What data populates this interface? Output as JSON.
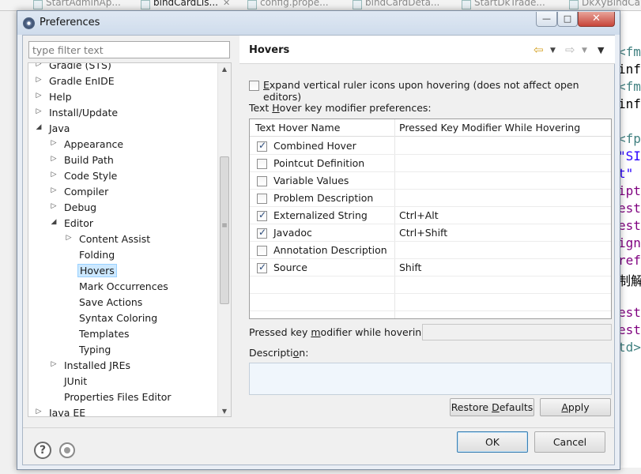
{
  "background_tabs": [
    {
      "label": "StartAdminAp...",
      "active": false
    },
    {
      "label": "bindCardLis...",
      "active": true
    },
    {
      "label": "config.prope...",
      "active": false
    },
    {
      "label": "bindCardDeta...",
      "active": false
    },
    {
      "label": "StartDkTrade...",
      "active": false
    },
    {
      "label": "DkXyBindCar",
      "active": false
    }
  ],
  "background_code": [
    {
      "text": "<fm",
      "color": "#3f7f7f"
    },
    {
      "text": "inf",
      "color": "#000000"
    },
    {
      "text": "<fm",
      "color": "#3f7f7f"
    },
    {
      "text": "inf",
      "color": "#000000"
    },
    {
      "text": "",
      "color": "#000000"
    },
    {
      "text": "<fp",
      "color": "#3f7f7f"
    },
    {
      "text": "\"SI",
      "color": "#2a00ff"
    },
    {
      "text": "t\"",
      "color": "#2a00ff"
    },
    {
      "text": "ipt",
      "color": "#7f007f"
    },
    {
      "text": "est",
      "color": "#7f007f"
    },
    {
      "text": "est",
      "color": "#7f007f"
    },
    {
      "text": "ign",
      "color": "#7f007f"
    },
    {
      "text": "ref",
      "color": "#7f007f"
    },
    {
      "text": "制解",
      "color": "#000000"
    },
    {
      "text": "",
      "color": "#000000"
    },
    {
      "text": "est",
      "color": "#7f007f"
    },
    {
      "text": "est",
      "color": "#7f007f"
    },
    {
      "text": "td>",
      "color": "#3f7f7f"
    }
  ],
  "dialog": {
    "title": "Preferences",
    "filter_placeholder": "type filter text",
    "window_buttons": {
      "minimize": "—",
      "maximize": "□",
      "close": "✕"
    }
  },
  "tree": [
    {
      "label": "Gradle (STS)",
      "level": 0,
      "arrow": "▷",
      "selected": false
    },
    {
      "label": "Gradle EnIDE",
      "level": 0,
      "arrow": "▷",
      "selected": false
    },
    {
      "label": "Help",
      "level": 0,
      "arrow": "▷",
      "selected": false
    },
    {
      "label": "Install/Update",
      "level": 0,
      "arrow": "▷",
      "selected": false
    },
    {
      "label": "Java",
      "level": 0,
      "arrow": "◢",
      "selected": false
    },
    {
      "label": "Appearance",
      "level": 1,
      "arrow": "▷",
      "selected": false
    },
    {
      "label": "Build Path",
      "level": 1,
      "arrow": "▷",
      "selected": false
    },
    {
      "label": "Code Style",
      "level": 1,
      "arrow": "▷",
      "selected": false
    },
    {
      "label": "Compiler",
      "level": 1,
      "arrow": "▷",
      "selected": false
    },
    {
      "label": "Debug",
      "level": 1,
      "arrow": "▷",
      "selected": false
    },
    {
      "label": "Editor",
      "level": 1,
      "arrow": "◢",
      "selected": false
    },
    {
      "label": "Content Assist",
      "level": 2,
      "arrow": "▷",
      "selected": false
    },
    {
      "label": "Folding",
      "level": 2,
      "arrow": "",
      "selected": false
    },
    {
      "label": "Hovers",
      "level": 2,
      "arrow": "",
      "selected": true
    },
    {
      "label": "Mark Occurrences",
      "level": 2,
      "arrow": "",
      "selected": false
    },
    {
      "label": "Save Actions",
      "level": 2,
      "arrow": "",
      "selected": false
    },
    {
      "label": "Syntax Coloring",
      "level": 2,
      "arrow": "",
      "selected": false
    },
    {
      "label": "Templates",
      "level": 2,
      "arrow": "",
      "selected": false
    },
    {
      "label": "Typing",
      "level": 2,
      "arrow": "",
      "selected": false
    },
    {
      "label": "Installed JREs",
      "level": 1,
      "arrow": "▷",
      "selected": false
    },
    {
      "label": "JUnit",
      "level": 1,
      "arrow": "",
      "selected": false
    },
    {
      "label": "Properties Files Editor",
      "level": 1,
      "arrow": "",
      "selected": false
    },
    {
      "label": "Java EE",
      "level": 0,
      "arrow": "▷",
      "selected": false
    }
  ],
  "page": {
    "title": "Hovers",
    "expand_label": "Expand vertical ruler icons upon hovering (does not affect open editors)",
    "expand_checked": false,
    "modifier_prefs_label": "Text Hover key modifier preferences:",
    "table_headers": {
      "name": "Text Hover Name",
      "modifier": "Pressed Key Modifier While Hovering"
    },
    "hovers": [
      {
        "name": "Combined Hover",
        "checked": true,
        "modifier": ""
      },
      {
        "name": "Pointcut Definition",
        "checked": false,
        "modifier": ""
      },
      {
        "name": "Variable Values",
        "checked": false,
        "modifier": ""
      },
      {
        "name": "Problem Description",
        "checked": false,
        "modifier": ""
      },
      {
        "name": "Externalized String",
        "checked": true,
        "modifier": "Ctrl+Alt"
      },
      {
        "name": "Javadoc",
        "checked": true,
        "modifier": "Ctrl+Shift"
      },
      {
        "name": "Annotation Description",
        "checked": false,
        "modifier": ""
      },
      {
        "name": "Source",
        "checked": true,
        "modifier": "Shift"
      }
    ],
    "pressed_key_label": "Pressed key modifier while hovering:",
    "pressed_key_value": "",
    "description_label": "Description:",
    "description_value": "",
    "restore_defaults": "Restore Defaults",
    "apply": "Apply"
  },
  "footer": {
    "help_symbol": "?",
    "ok": "OK",
    "cancel": "Cancel"
  },
  "nav": {
    "back_icon": "⇦",
    "forward_icon": "⇨",
    "dropdown_icon": "▼",
    "menu_icon": "▼"
  },
  "colors": {
    "selection": "#cce8ff",
    "dialog_frame": "#7d8da1",
    "back_arrow": "#d4a020"
  }
}
